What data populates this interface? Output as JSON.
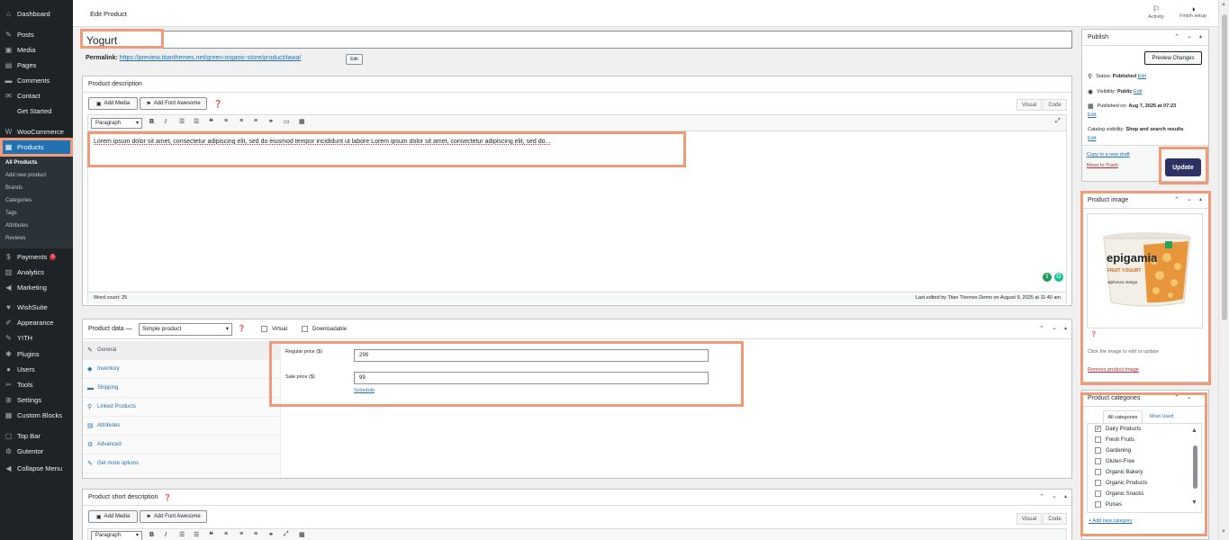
{
  "sidebar": {
    "items": [
      {
        "label": "Dashboard",
        "icon": "dashboard-icon",
        "glyph": "⌂"
      },
      {
        "label": "Posts",
        "icon": "pin-icon",
        "glyph": "✎"
      },
      {
        "label": "Media",
        "icon": "media-icon",
        "glyph": "▣"
      },
      {
        "label": "Pages",
        "icon": "pages-icon",
        "glyph": "▤"
      },
      {
        "label": "Comments",
        "icon": "comments-icon",
        "glyph": "▬"
      },
      {
        "label": "Contact",
        "icon": "mail-icon",
        "glyph": "✉"
      },
      {
        "label": "Get Started",
        "icon": "",
        "glyph": ""
      },
      {
        "label": "WooCommerce",
        "icon": "woo-icon",
        "glyph": "W"
      },
      {
        "label": "Products",
        "icon": "products-icon",
        "glyph": "▦"
      },
      {
        "label": "Payments",
        "icon": "payments-icon",
        "glyph": "$",
        "badge": "1"
      },
      {
        "label": "Analytics",
        "icon": "analytics-icon",
        "glyph": "▥"
      },
      {
        "label": "Marketing",
        "icon": "megaphone-icon",
        "glyph": "◀"
      },
      {
        "label": "WishSuite",
        "icon": "heart-icon",
        "glyph": "♥"
      },
      {
        "label": "Appearance",
        "icon": "brush-icon",
        "glyph": "✐"
      },
      {
        "label": "YITH",
        "icon": "yith-icon",
        "glyph": "✎"
      },
      {
        "label": "Plugins",
        "icon": "plugin-icon",
        "glyph": "✱"
      },
      {
        "label": "Users",
        "icon": "users-icon",
        "glyph": "●"
      },
      {
        "label": "Tools",
        "icon": "tools-icon",
        "glyph": "✂"
      },
      {
        "label": "Settings",
        "icon": "settings-icon",
        "glyph": "⊞"
      },
      {
        "label": "Custom Blocks",
        "icon": "blocks-icon",
        "glyph": "▦"
      },
      {
        "label": "Top Bar",
        "icon": "topbar-icon",
        "glyph": "▢"
      },
      {
        "label": "Gutentor",
        "icon": "gutentor-icon",
        "glyph": "⚙"
      },
      {
        "label": "Collapse Menu",
        "icon": "collapse-icon",
        "glyph": "◀"
      }
    ],
    "sub_items": [
      "All Products",
      "Add new product",
      "Brands",
      "Categories",
      "Tags",
      "Attributes",
      "Reviews"
    ]
  },
  "topbar": {
    "title": "Edit Product",
    "activity": "Activity",
    "finish_setup": "Finish setup"
  },
  "product": {
    "title": "Yogurt",
    "permalink_label": "Permalink:",
    "permalink_url": "https://preview.titanthemes.net/green-organic-store/product/tawa/",
    "edit_label": "Edit"
  },
  "description": {
    "header": "Product description",
    "add_media": "Add Media",
    "add_font": "Add Font Awesome",
    "tab_visual": "Visual",
    "tab_code": "Code",
    "format": "Paragraph",
    "content": "Lorem ipsum dolor sit amet, consectetur adipiscing elit, sed do eiusmod tempor incididunt ut labore Lorem ipsum dolor sit amet, consectetur adipiscing elit, sed do...",
    "word_count": "Word count: 25",
    "last_edited": "Last edited by Titan Themes Demo on August 9, 2025 at 11:40 am"
  },
  "product_data": {
    "header": "Product data —",
    "type": "Simple product",
    "virtual": "Virtual",
    "downloadable": "Downloadable",
    "tabs": [
      {
        "label": "General",
        "glyph": "✎"
      },
      {
        "label": "Inventory",
        "glyph": "◆"
      },
      {
        "label": "Shipping",
        "glyph": "▬"
      },
      {
        "label": "Linked Products",
        "glyph": "⚲"
      },
      {
        "label": "Attributes",
        "glyph": "▤"
      },
      {
        "label": "Advanced",
        "glyph": "⚙"
      },
      {
        "label": "Get more options",
        "glyph": "✎"
      }
    ],
    "regular_price_label": "Regular price ($)",
    "regular_price": "299",
    "sale_price_label": "Sale price ($)",
    "sale_price": "99",
    "schedule": "Schedule"
  },
  "short_description": {
    "header": "Product short description",
    "add_media": "Add Media",
    "add_font": "Add Font Awesome",
    "tab_visual": "Visual",
    "tab_code": "Code",
    "format": "Paragraph"
  },
  "publish": {
    "header": "Publish",
    "preview": "Preview Changes",
    "status_label": "Status:",
    "status": "Published",
    "visibility_label": "Visibility:",
    "visibility": "Public",
    "published_label": "Published on:",
    "published": "Aug 7, 2025 at 07:23",
    "catalog_label": "Catalog visibility:",
    "catalog": "Shop and search results",
    "edit": "Edit",
    "copy_draft": "Copy to a new draft",
    "trash": "Move to Trash",
    "update": "Update"
  },
  "product_image": {
    "header": "Product image",
    "brand": "epigamia",
    "flavor": "FRUIT YOGURT",
    "variant": "alphonso mango",
    "hint": "Click the image to edit or update",
    "remove": "Remove product image"
  },
  "categories": {
    "header": "Product categories",
    "tab_all": "All categories",
    "tab_used": "Most Used",
    "items": [
      {
        "label": "Dairy Products",
        "checked": true
      },
      {
        "label": "Fresh Fruits",
        "checked": false
      },
      {
        "label": "Gardening",
        "checked": false
      },
      {
        "label": "Gluten-Free",
        "checked": false
      },
      {
        "label": "Organic Bakery",
        "checked": false
      },
      {
        "label": "Organic Products",
        "checked": false
      },
      {
        "label": "Organic Snacks",
        "checked": false
      },
      {
        "label": "Pulses",
        "checked": false
      }
    ],
    "add_new": "+ Add new category"
  },
  "colors": {
    "accent": "#2271b1",
    "highlight": "#f09a77",
    "update_btn": "#2c3262",
    "sidebar": "#1d2327"
  }
}
